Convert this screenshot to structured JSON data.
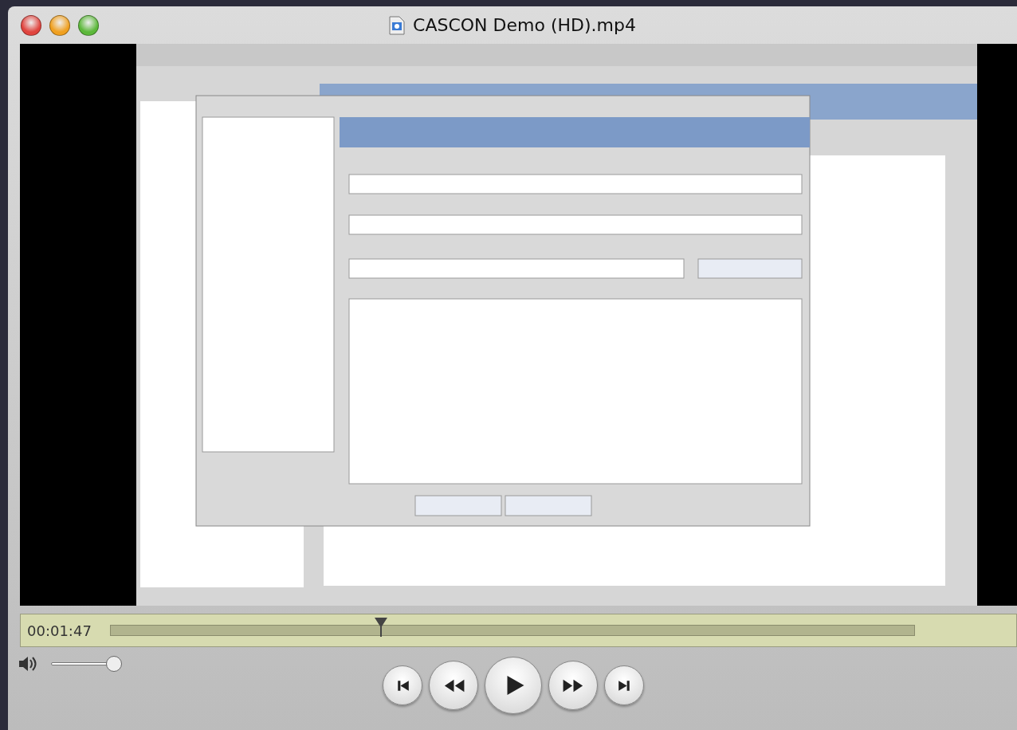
{
  "window": {
    "title": "CASCON Demo (HD).mp4",
    "buttons": [
      {
        "kind": "close"
      },
      {
        "kind": "minimize"
      },
      {
        "kind": "zoom"
      }
    ]
  },
  "timeline": {
    "time": "00:01:47",
    "level": 0.336
  },
  "volume": {
    "level": 1
  },
  "controls": [
    {
      "kind": "previous"
    },
    {
      "kind": "rewind"
    },
    {
      "kind": "play"
    },
    {
      "kind": "forward"
    },
    {
      "kind": "next"
    }
  ]
}
